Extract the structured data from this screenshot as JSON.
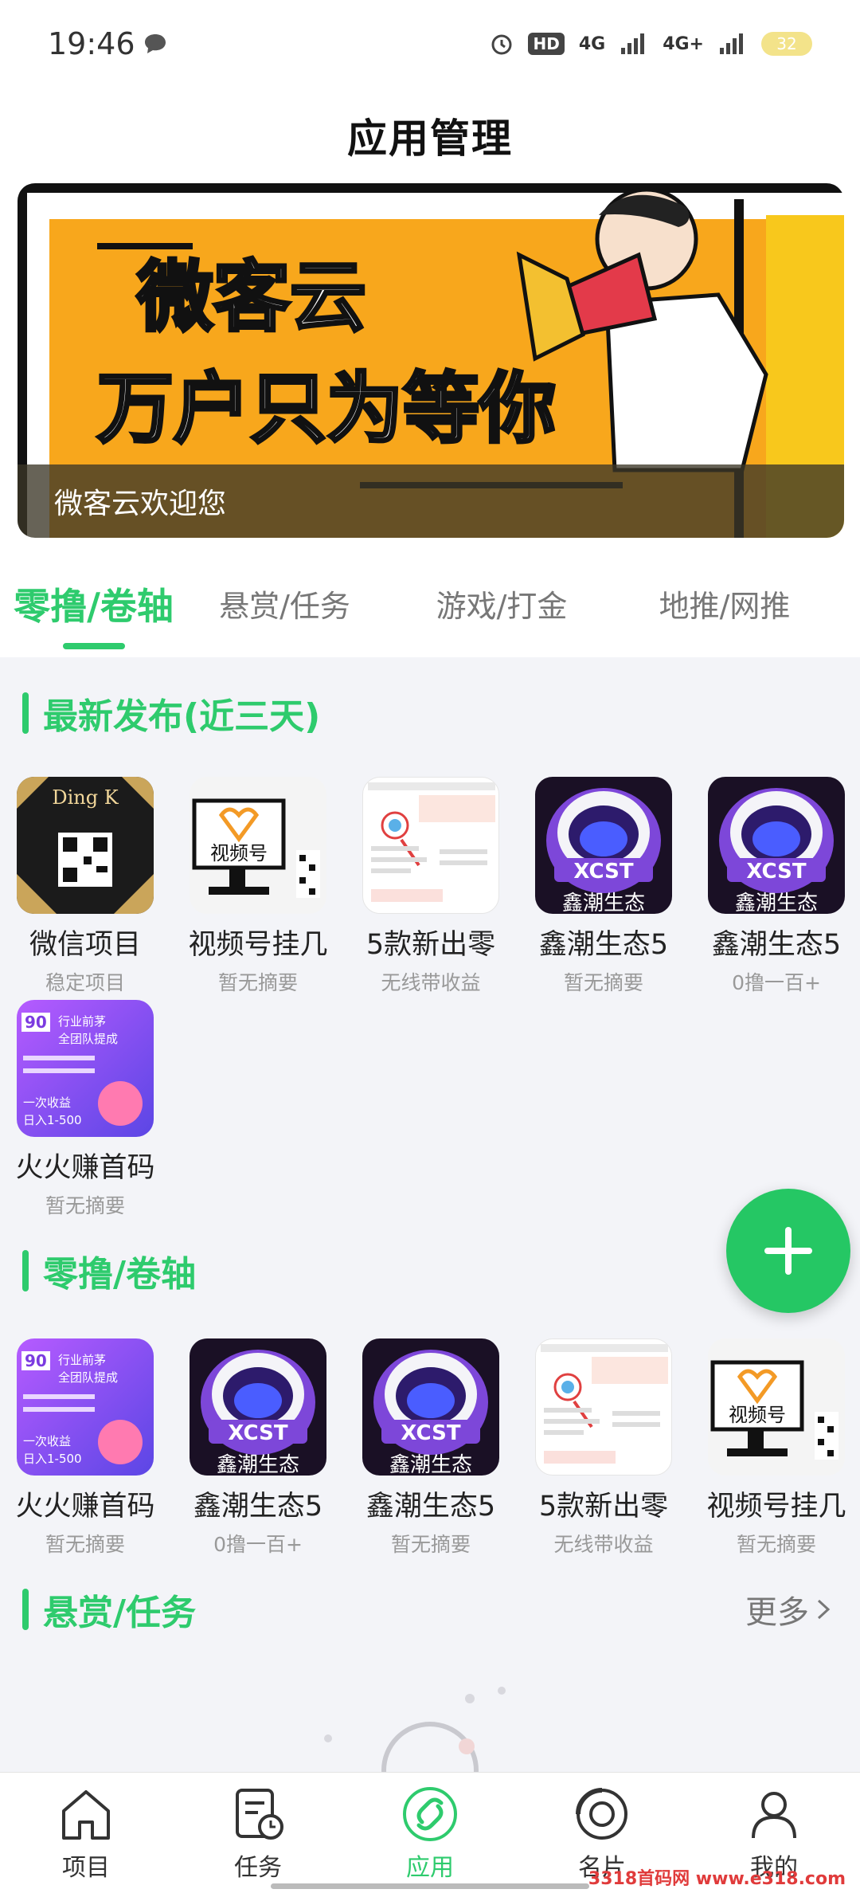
{
  "status_bar": {
    "time": "19:46",
    "hd_label": "HD",
    "net1": "4G",
    "net2": "4G+",
    "battery": "32"
  },
  "header": {
    "title": "应用管理"
  },
  "banner": {
    "line1": "微客云",
    "line2": "万户只为等你",
    "caption": "微客云欢迎您"
  },
  "tabs": [
    {
      "label": "零撸/卷轴",
      "active": true
    },
    {
      "label": "悬赏/任务",
      "active": false
    },
    {
      "label": "游戏/打金",
      "active": false
    },
    {
      "label": "地推/网推",
      "active": false
    }
  ],
  "sections": {
    "latest": {
      "title": "最新发布(近三天)"
    },
    "zero": {
      "title": "零撸/卷轴"
    },
    "reward": {
      "title": "悬赏/任务",
      "more": "更多"
    }
  },
  "latest_apps": [
    {
      "name": "微信项目",
      "desc": "稳定项目",
      "icon": "dingk-qr-icon"
    },
    {
      "name": "视频号挂几",
      "desc": "暂无摘要",
      "icon": "video-channel-icon"
    },
    {
      "name": "5款新出零",
      "desc": "无线带收益",
      "icon": "screenshot-icon"
    },
    {
      "name": "鑫潮生态5",
      "desc": "暂无摘要",
      "icon": "xcst-astronaut-icon"
    },
    {
      "name": "鑫潮生态5",
      "desc": "0撸一百+",
      "icon": "xcst-astronaut-icon"
    },
    {
      "name": "火火赚首码",
      "desc": "暂无摘要",
      "icon": "huohuo-promo-icon"
    }
  ],
  "zero_apps": [
    {
      "name": "火火赚首码",
      "desc": "暂无摘要",
      "icon": "huohuo-promo-icon"
    },
    {
      "name": "鑫潮生态5",
      "desc": "0撸一百+",
      "icon": "xcst-astronaut-icon"
    },
    {
      "name": "鑫潮生态5",
      "desc": "暂无摘要",
      "icon": "xcst-astronaut-icon"
    },
    {
      "name": "5款新出零",
      "desc": "无线带收益",
      "icon": "screenshot-icon"
    },
    {
      "name": "视频号挂几",
      "desc": "暂无摘要",
      "icon": "video-channel-icon"
    }
  ],
  "icon_texts": {
    "dingk": "Ding K",
    "video": "视频号",
    "xcst": "XCST",
    "xcst_cn": "鑫潮生态",
    "huohuo_num": "90",
    "huohuo_line1": "行业前茅",
    "huohuo_line2": "全团队提成",
    "huohuo_line3": "一次收益",
    "huohuo_line4": "日入1-500"
  },
  "bottom_nav": [
    {
      "label": "项目",
      "icon": "home-icon",
      "active": false
    },
    {
      "label": "任务",
      "icon": "task-icon",
      "active": false
    },
    {
      "label": "应用",
      "icon": "apps-icon",
      "active": true
    },
    {
      "label": "名片",
      "icon": "card-icon",
      "active": false
    },
    {
      "label": "我的",
      "icon": "profile-icon",
      "active": false
    }
  ],
  "watermark": "3318首码网 www.e318.com",
  "colors": {
    "accent": "#2ecb6d",
    "fab": "#25c764"
  }
}
